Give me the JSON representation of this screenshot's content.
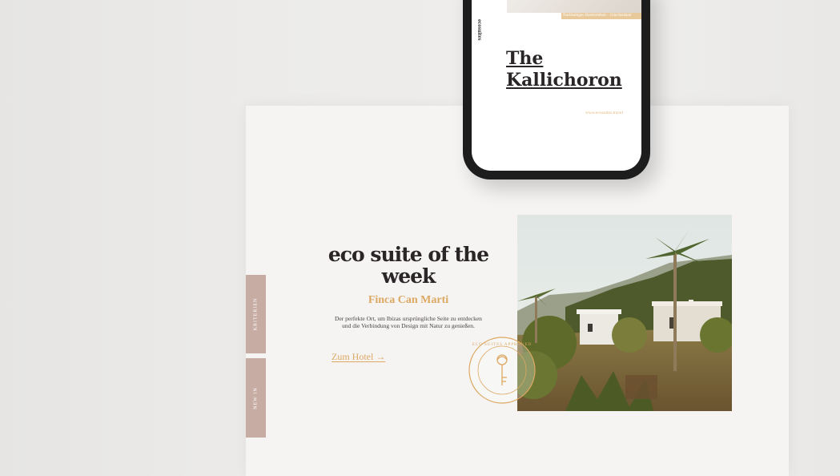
{
  "hero": {
    "headline": "eco suite of the week",
    "subhead": "Finca Can Marti",
    "description": "Der perfekte Ort, um Ibizas ursprüngliche Seite zu entdecken und die Verbindung von Design mit Natur zu genießen.",
    "cta_label": "Zum Hotel →"
  },
  "side_tabs": [
    {
      "label": "KRITERIEN"
    },
    {
      "label": "NEW IN"
    }
  ],
  "seal": {
    "label": "ECO SUITES APPROVED"
  },
  "phone": {
    "brand": "ecosuites",
    "meta": "Nachhaltiges Hotelerlebnis · Griechenland",
    "title_line1": "The",
    "title_line2": "Kallichoron",
    "link": "www.ecosuites.travel"
  },
  "colors": {
    "accent": "#dca862",
    "tab": "#c7aca4",
    "text_dark": "#2a2526"
  }
}
